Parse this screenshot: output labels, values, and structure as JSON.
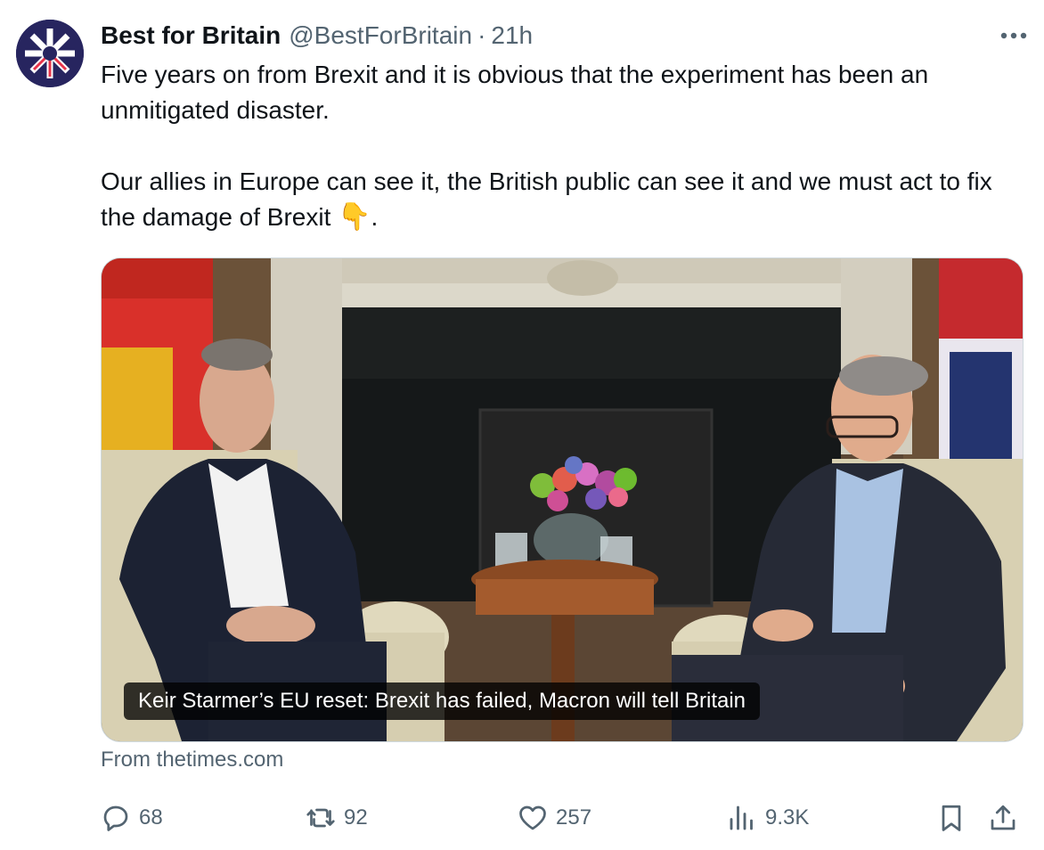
{
  "tweet": {
    "author_name": "Best for Britain",
    "handle": "@BestForBritain",
    "separator": "·",
    "time": "21h",
    "avatar_icon": "union-flag-star-logo",
    "more_icon": "more-horizontal-icon",
    "text_line_1": "Five years on from Brexit and it is obvious that the experiment has been an unmitigated disaster.",
    "text_line_2": "Our allies in Europe can see it, the British public can see it and we must act to fix the damage of Brexit",
    "emoji": "👇",
    "emoji_name": "backhand-index-pointing-down",
    "text_end": "."
  },
  "media": {
    "caption": "Keir Starmer’s EU reset: Brexit has failed, Macron will tell Britain",
    "source": "From thetimes.com"
  },
  "actions": {
    "reply": {
      "icon": "reply-icon",
      "count": "68"
    },
    "retweet": {
      "icon": "retweet-icon",
      "count": "92"
    },
    "like": {
      "icon": "heart-icon",
      "count": "257"
    },
    "views": {
      "icon": "views-chart-icon",
      "count": "9.3K"
    },
    "bookmark": {
      "icon": "bookmark-icon"
    },
    "share": {
      "icon": "share-icon"
    }
  },
  "colors": {
    "text_primary": "#0f1419",
    "text_secondary": "#536471",
    "avatar_bg": "#27255f",
    "border": "#cfd9de"
  }
}
